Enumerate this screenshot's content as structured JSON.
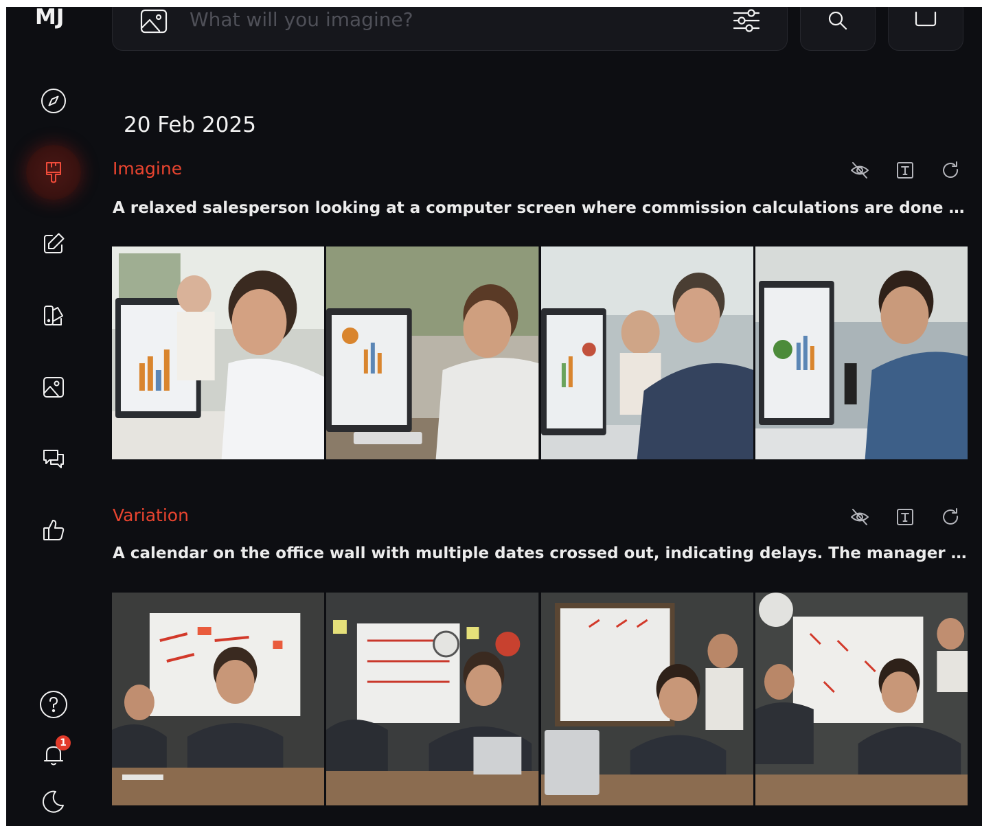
{
  "sidebar": {
    "logo": "MJ",
    "notification_count": "1"
  },
  "search": {
    "placeholder": "What will you imagine?"
  },
  "feed": {
    "date": "20 Feb 2025",
    "jobs": [
      {
        "type": "Imagine",
        "prompt": "A relaxed salesperson looking at a computer screen where commission calculations are done au..."
      },
      {
        "type": "Variation",
        "prompt": "A calendar on the office wall with multiple dates crossed out, indicating delays. The manager loo..."
      }
    ]
  },
  "colors": {
    "accent": "#e8442f",
    "background": "#0d0e12",
    "panel": "#16171c"
  }
}
